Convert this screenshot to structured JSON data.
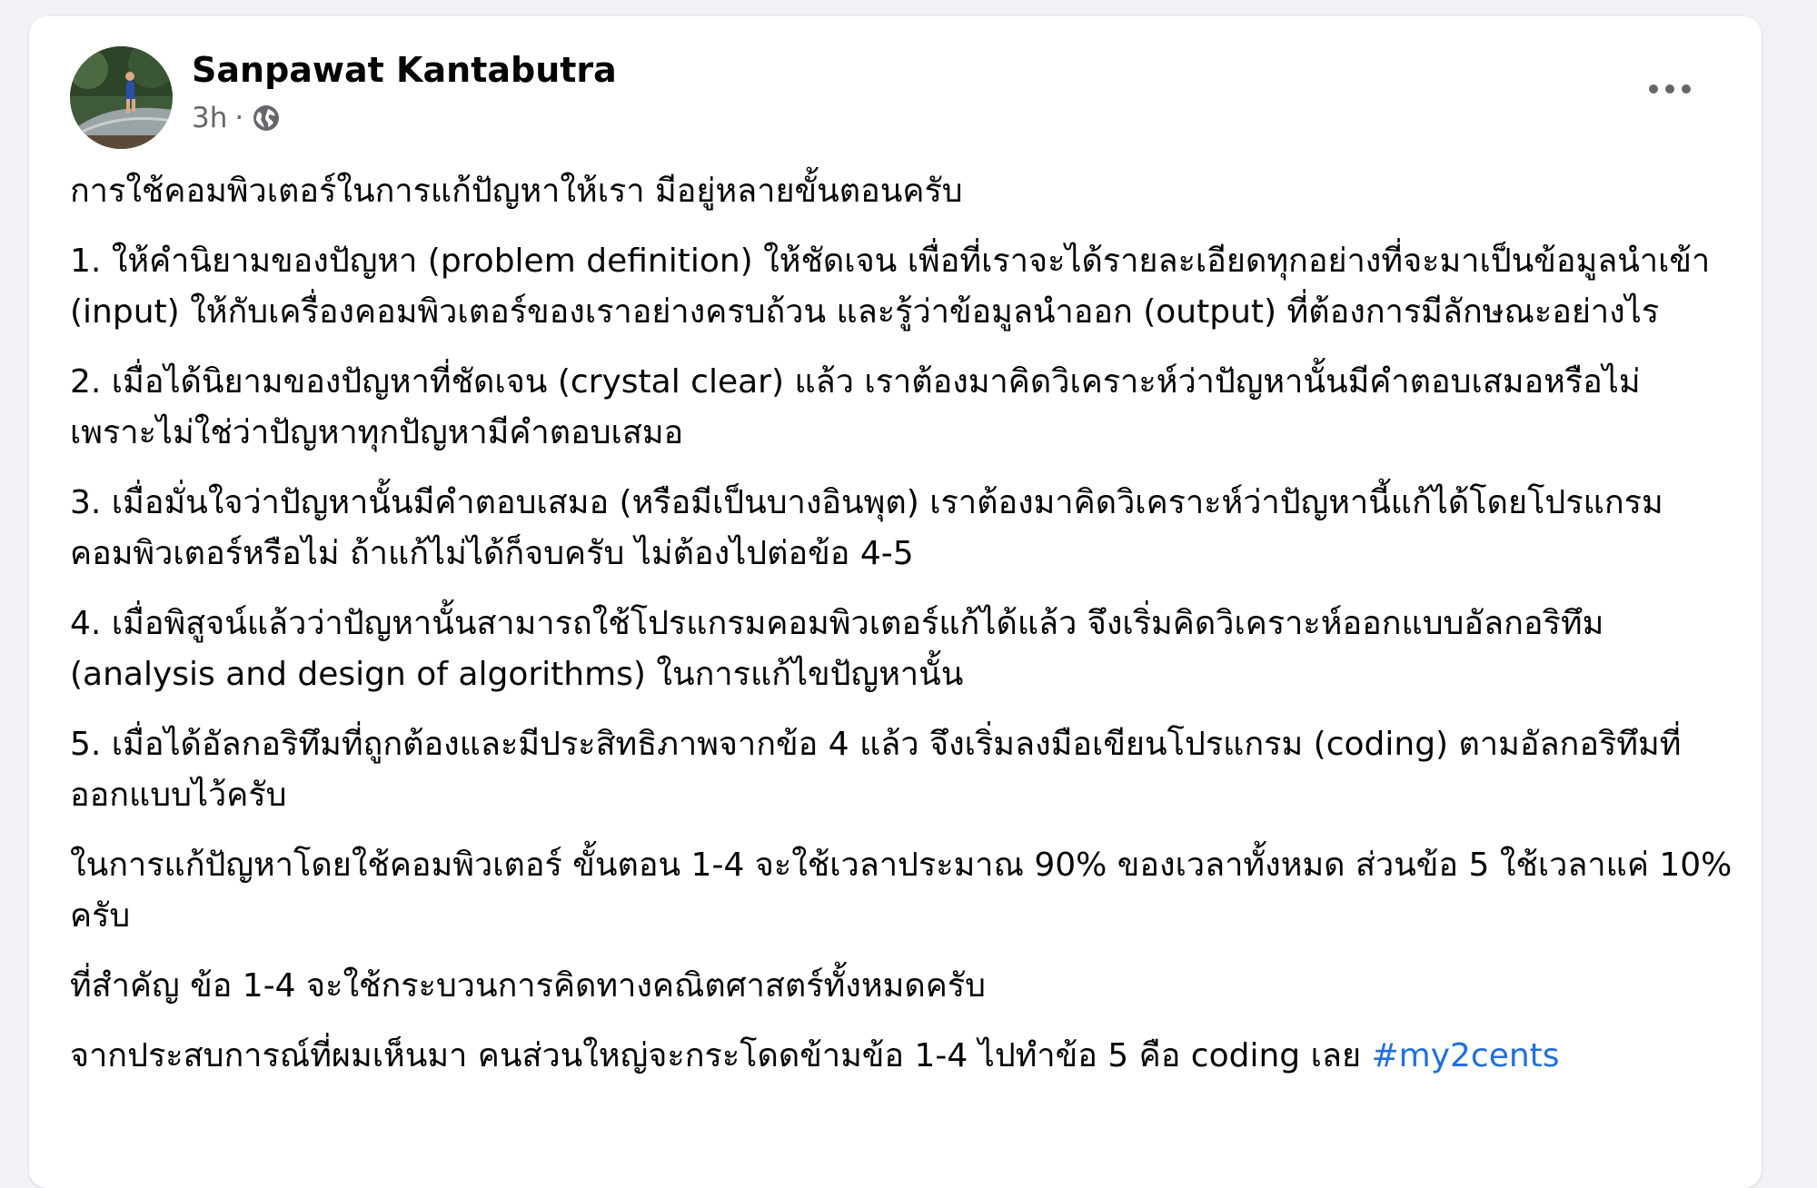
{
  "post": {
    "author": "Sanpawat Kantabutra",
    "time": "3h",
    "separator": "·",
    "audience_icon": "globe-icon",
    "more_icon": "more-horizontal-icon",
    "avatar_icon": "avatar-photo-runner",
    "paragraphs": [
      "การใช้คอมพิวเตอร์ในการแก้ปัญหาให้เรา มีอยู่หลายขั้นตอนครับ",
      "1. ให้คำนิยามของปัญหา (problem definition) ให้ชัดเจน เพื่อที่เราจะได้รายละเอียดทุกอย่างที่จะมาเป็นข้อมูลนำเข้า (input) ให้กับเครื่องคอมพิวเตอร์ของเราอย่างครบถ้วน และรู้ว่าข้อมูลนำออก (output) ที่ต้องการมีลักษณะอย่างไร",
      "2. เมื่อได้นิยามของปัญหาที่ชัดเจน (crystal clear) แล้ว เราต้องมาคิดวิเคราะห์ว่าปัญหานั้นมีคำตอบเสมอหรือไม่ เพราะไม่ใช่ว่าปัญหาทุกปัญหามีคำตอบเสมอ",
      "3. เมื่อมั่นใจว่าปัญหานั้นมีคำตอบเสมอ (หรือมีเป็นบางอินพุต) เราต้องมาคิดวิเคราะห์ว่าปัญหานี้แก้ได้โดยโปรแกรมคอมพิวเตอร์หรือไม่ ถ้าแก้ไม่ได้ก็จบครับ ไม่ต้องไปต่อข้อ 4-5",
      "4. เมื่อพิสูจน์แล้วว่าปัญหานั้นสามารถใช้โปรแกรมคอมพิวเตอร์แก้ได้แล้ว จึงเริ่มคิดวิเคราะห์ออกแบบอัลกอริทึม (analysis and design of algorithms) ในการแก้ไขปัญหานั้น",
      "5. เมื่อได้อัลกอริทึมที่ถูกต้องและมีประสิทธิภาพจากข้อ 4 แล้ว จึงเริ่มลงมือเขียนโปรแกรม (coding) ตามอัลกอริทึมที่ออกแบบไว้ครับ",
      "ในการแก้ปัญหาโดยใช้คอมพิวเตอร์ ขั้นตอน 1-4 จะใช้เวลาประมาณ 90% ของเวลาทั้งหมด ส่วนข้อ 5 ใช้เวลาแค่ 10% ครับ",
      "ที่สำคัญ ข้อ 1-4 จะใช้กระบวนการคิดทางคณิตศาสตร์ทั้งหมดครับ"
    ],
    "last_paragraph": "จากประสบการณ์ที่ผมเห็นมา คนส่วนใหญ่จะกระโดดข้ามข้อ 1-4 ไปทำข้อ 5 คือ coding เลย ",
    "hashtag": "#my2cents",
    "colors": {
      "text": "#050505",
      "meta": "#65676b",
      "link": "#216fdb",
      "card": "#ffffff",
      "background": "#f0f2f5"
    }
  }
}
